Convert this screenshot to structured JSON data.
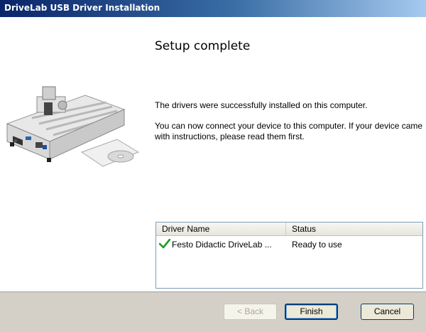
{
  "window": {
    "title": "DriveLab USB Driver Installation"
  },
  "content": {
    "heading": "Setup complete",
    "paragraph1": "The drivers were successfully installed on this computer.",
    "paragraph2": "You can now connect your device to this computer. If your device came with instructions, please read them first."
  },
  "driver_list": {
    "columns": [
      "Driver Name",
      "Status"
    ],
    "rows": [
      {
        "name": "Festo Didactic DriveLab ...",
        "status": "Ready to use",
        "icon": "checkmark-icon"
      }
    ]
  },
  "buttons": {
    "back": "< Back",
    "finish": "Finish",
    "cancel": "Cancel"
  },
  "colors": {
    "titlebar": "#0a246a",
    "check": "#1f9a1f",
    "bottom_bar": "#d4d0c8"
  }
}
